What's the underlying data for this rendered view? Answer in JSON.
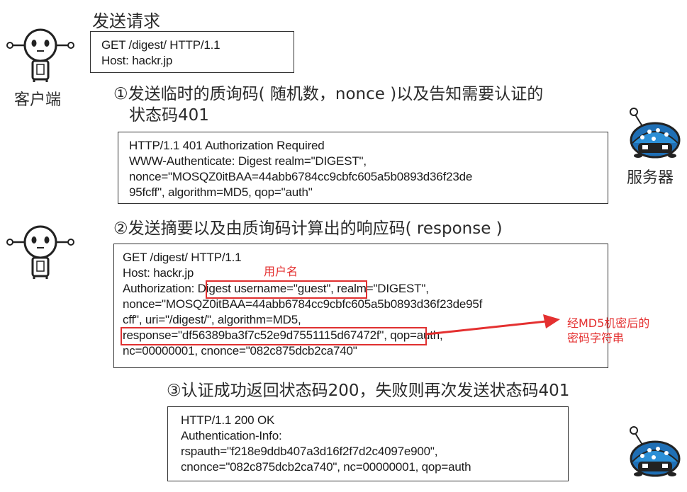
{
  "title": "发送请求",
  "roles": {
    "client": "客户端",
    "server": "服务器"
  },
  "request1": {
    "lines": [
      "GET /digest/ HTTP/1.1",
      "Host: hackr.jp"
    ]
  },
  "step1": {
    "line1": "①发送临时的质询码( 随机数，nonce )以及告知需要认证的",
    "line2": "状态码401"
  },
  "response1": {
    "lines": [
      "HTTP/1.1 401 Authorization Required",
      "WWW-Authenticate: Digest realm=\"DIGEST\",",
      "nonce=\"MOSQZ0itBAA=44abb6784cc9cbfc605a5b0893d36f23de",
      "95fcff\", algorithm=MD5, qop=\"auth\""
    ]
  },
  "step2": {
    "line1": "②发送摘要以及由质询码计算出的响应码( response )"
  },
  "request2": {
    "lines": [
      "GET /digest/ HTTP/1.1",
      "Host: hackr.jp",
      "Authorization: Digest username=\"guest\", realm=\"DIGEST\",",
      "nonce=\"MOSQZ0itBAA=44abb6784cc9cbfc605a5b0893d36f23de95f",
      "cff\", uri=\"/digest/\", algorithm=MD5,",
      "response=\"df56389ba3f7c52e9d7551115d67472f\", qop=auth,",
      "nc=00000001, cnonce=\"082c875dcb2ca740\""
    ]
  },
  "annotations": {
    "username_label": "用户名",
    "md5_line1": "经MD5机密后的",
    "md5_line2": "密码字符串"
  },
  "step3": {
    "line1": "③认证成功返回状态码200，失败则再次发送状态码401"
  },
  "response2": {
    "lines": [
      "HTTP/1.1 200 OK",
      "Authentication-Info:",
      "rspauth=\"f218e9ddb407a3d16f2f7d2c4097e900\",",
      "cnonce=\"082c875dcb2ca740\", nc=00000001, qop=auth"
    ]
  },
  "colors": {
    "annotation_red": "#e43030",
    "server_robot_blue": "#1f6fb5"
  },
  "icons": [
    "client-robot-icon",
    "server-robot-icon",
    "red-arrow-icon"
  ]
}
